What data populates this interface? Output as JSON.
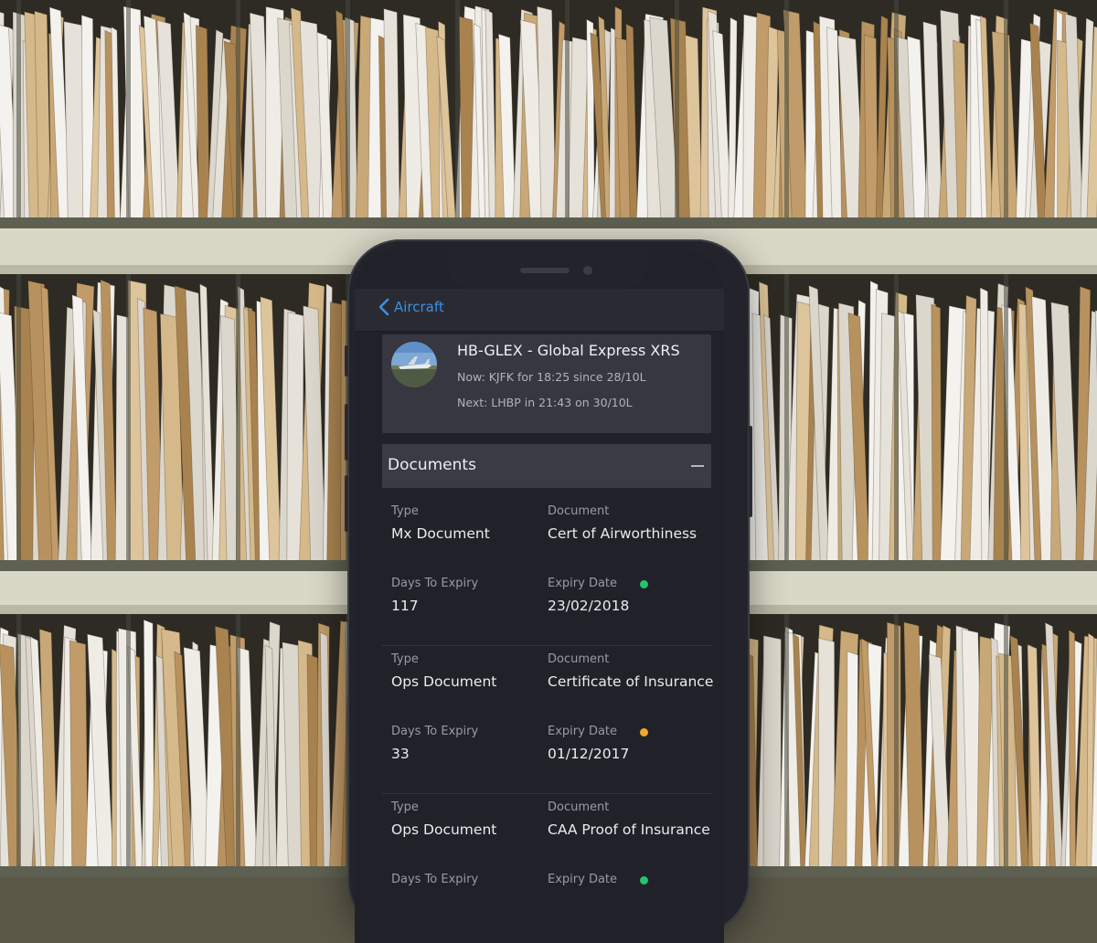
{
  "nav": {
    "back_label": "Aircraft"
  },
  "aircraft": {
    "title": "HB-GLEX - Global Express XRS",
    "now": "Now: KJFK for 18:25 since 28/10L",
    "next": "Next: LHBP in 21:43 on 30/10L"
  },
  "documents": {
    "header": "Documents",
    "type_label": "Type",
    "document_label": "Document",
    "days_label": "Days To Expiry",
    "expiry_label": "Expiry Date",
    "items": [
      {
        "type": "Mx Document",
        "document": "Cert of Airworthiness",
        "days": "117",
        "expiry": "23/02/2018",
        "status": "green"
      },
      {
        "type": "Ops Document",
        "document": "Certificate of Insurance",
        "days": "33",
        "expiry": "01/12/2017",
        "status": "amber"
      },
      {
        "type": "Ops Document",
        "document": "CAA Proof of Insurance",
        "days": "",
        "expiry": "",
        "status": "green"
      }
    ]
  },
  "colors": {
    "accent": "#3c8fe6",
    "status_green": "#23c46b",
    "status_amber": "#f2a925"
  }
}
